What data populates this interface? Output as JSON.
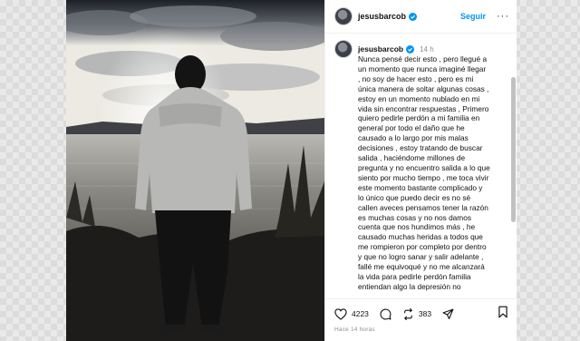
{
  "header": {
    "username": "jesusbarcob",
    "follow_label": "Seguir",
    "more_label": "···"
  },
  "caption": {
    "username": "jesusbarcob",
    "time": "14 h",
    "text": "Nunca pensé decir esto , pero llegué a\nun momento que nunca imaginé llegar\n, no soy de hacer esto , pero es mi\núnica manera de soltar algunas cosas ,\nestoy en un momento nublado en mi\nvida sin encontrar respuestas , Primero\nquiero pedirle perdón a mi familia en\ngeneral por todo el daño que he\ncausado a lo largo por mis malas\ndecisiones , estoy tratando de buscar\nsalida , haciéndome millones de\npregunta y no encuentro salida a lo que\nsiento por mucho tiempo , me toca vivir\neste momento bastante complicado y\nlo único que puedo decir es no  sé\ncallen aveces pensamos tener la razón\nes muchas cosas y no nos damos\ncuenta que nos hundimos más , he\ncausado muchas heridas a todos que\nme rompieron por completo por dentro\ny que no logro sanar y salir adelante ,\nfallé me equivoqué y no me alcanzará\nla vida para pedirle perdón familia\nentiendan algo la depresión no"
  },
  "actions": {
    "likes": "4223",
    "reposts": "383",
    "posted": "Hace 14 horas"
  },
  "colors": {
    "accent": "#0095f6",
    "verified": "#0095f6",
    "muted": "#8e8e8e"
  },
  "icons": {
    "like": "heart-icon",
    "comment": "comment-icon",
    "repost": "repost-icon",
    "share": "share-icon",
    "save": "bookmark-icon"
  }
}
